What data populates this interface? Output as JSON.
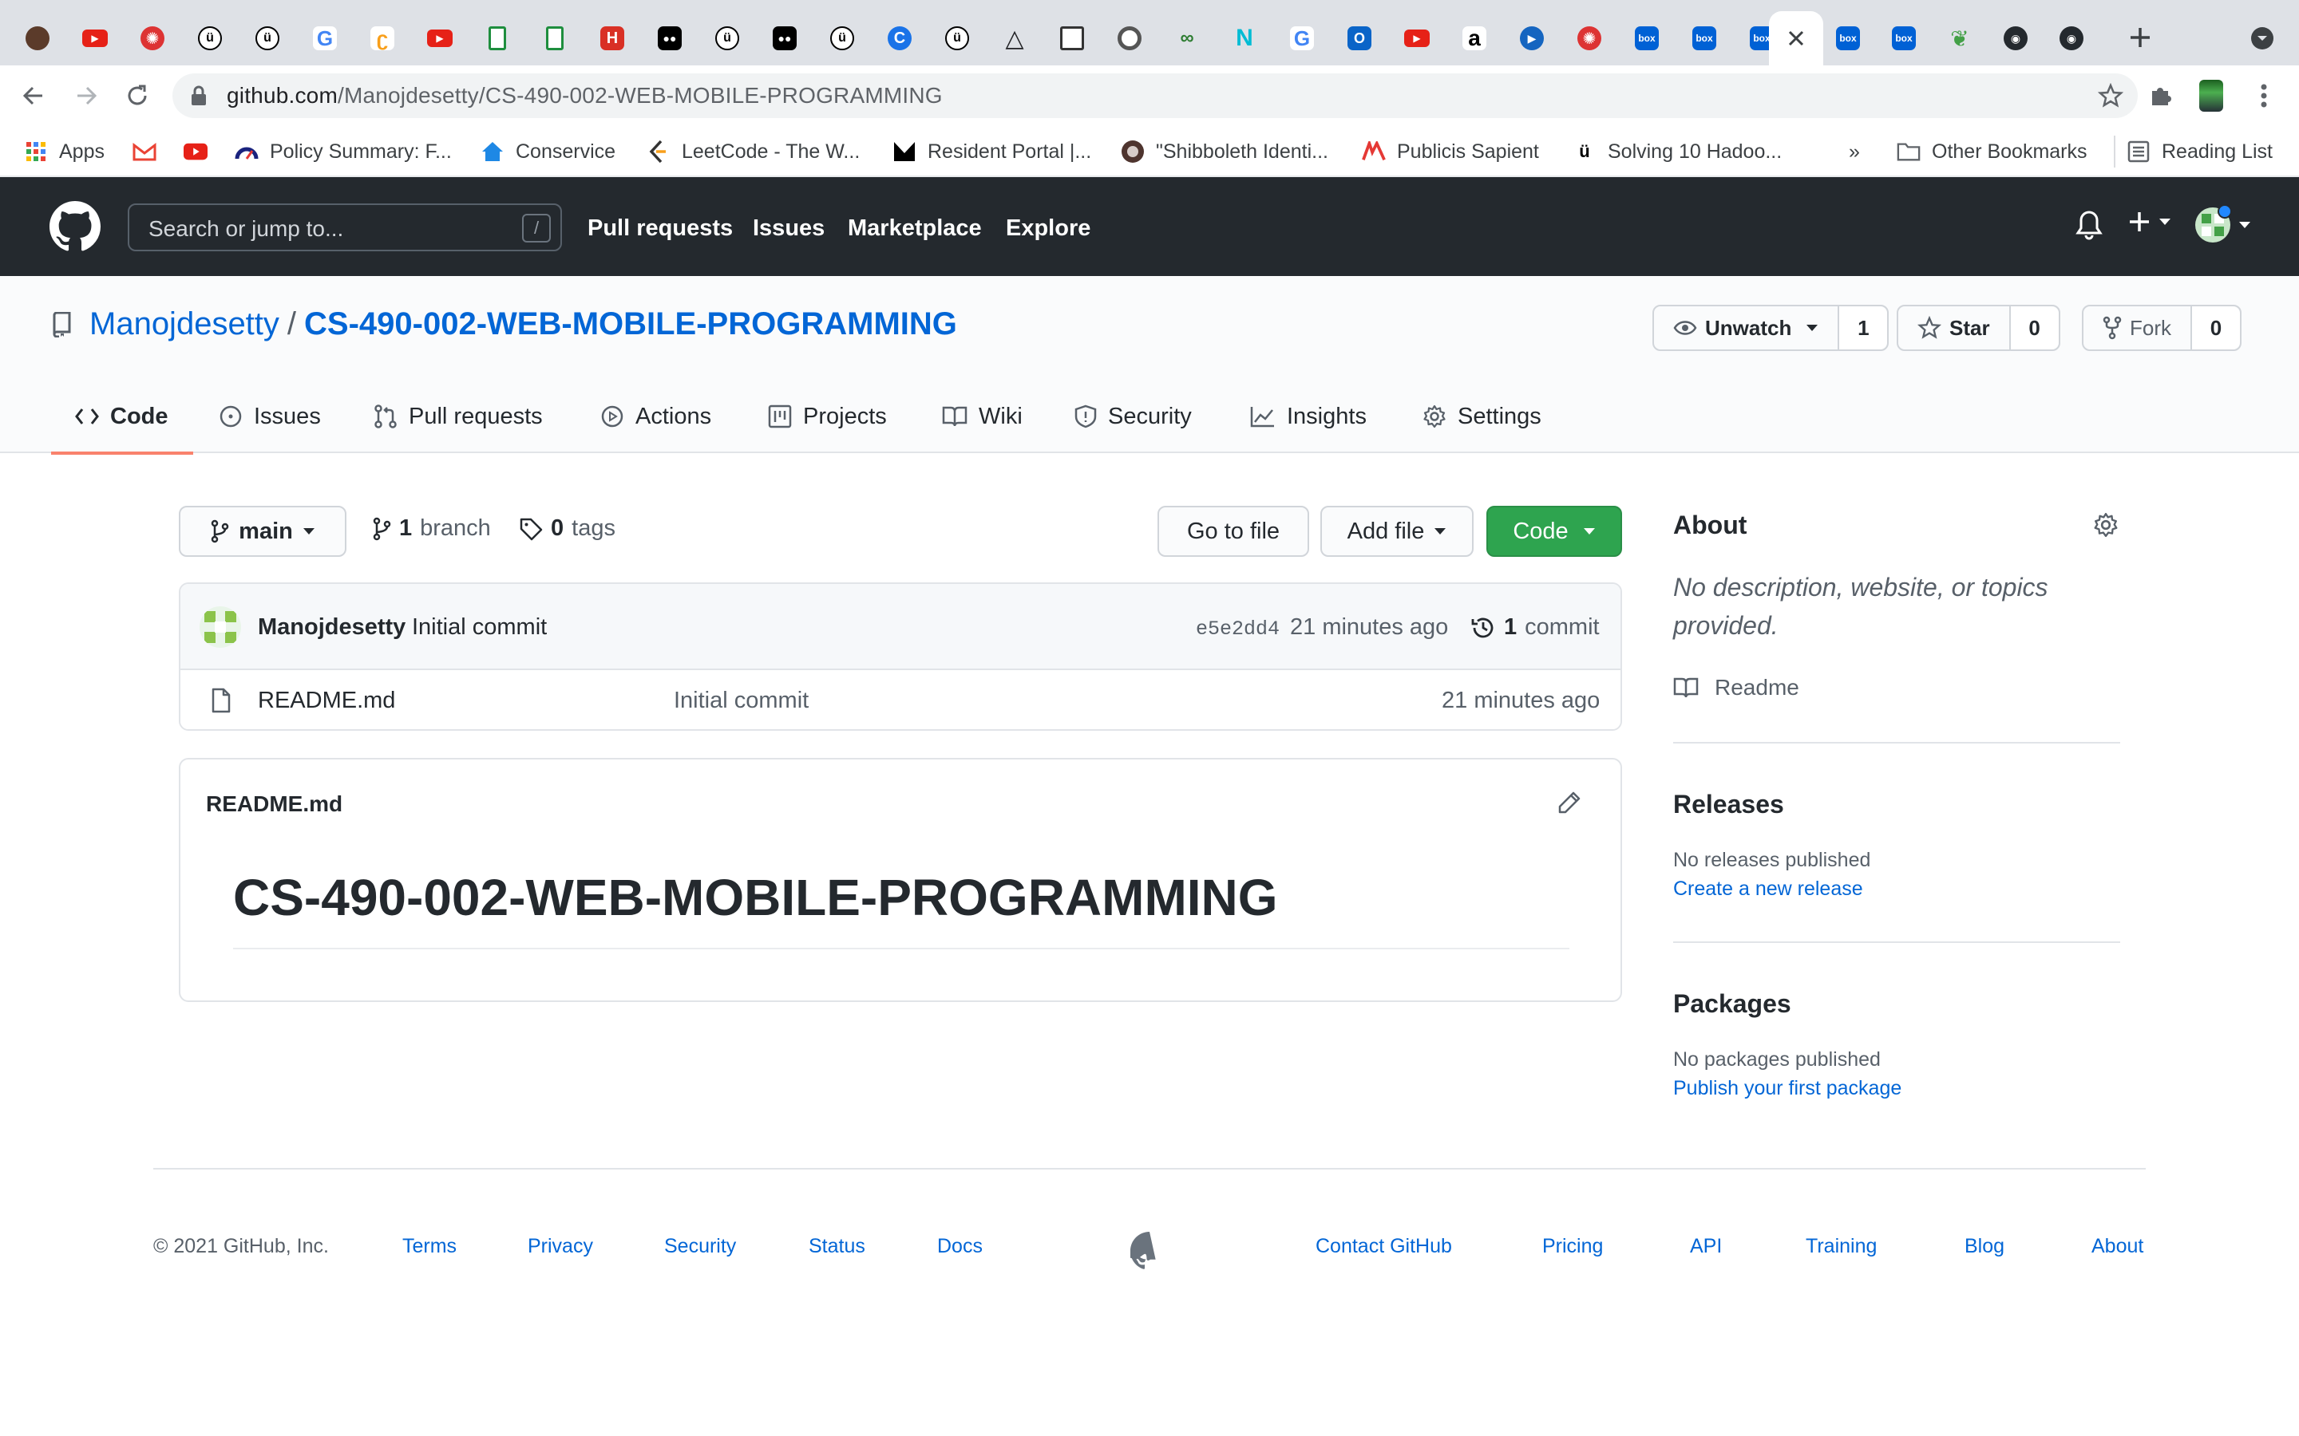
{
  "browser": {
    "tabs_favicon_names": [
      "chrome-icon",
      "youtube-icon",
      "stevens-icon",
      "udemy-icon",
      "udemy-icon",
      "google-icon",
      "leetcode-icon",
      "youtube-icon",
      "doc-icon",
      "doc-icon",
      "hackerrank-icon",
      "medium-icon",
      "udemy-icon",
      "medium-icon",
      "c-icon",
      "udemy-icon",
      "triangle-icon",
      "book-icon",
      "chrome-icon",
      "link-icon",
      "n-icon",
      "google-icon",
      "outlook-icon",
      "youtube-icon",
      "amazon-icon",
      "play-icon",
      "stevens-icon",
      "box-icon",
      "box-icon",
      "box-icon",
      "github-icon",
      "box-icon",
      "box-icon",
      "leaf-icon",
      "github-icon",
      "github-icon"
    ],
    "url_host": "github.com",
    "url_path": "/Manojdesetty/CS-490-002-WEB-MOBILE-PROGRAMMING",
    "bookmarks": {
      "apps": "Apps",
      "policy": "Policy Summary: F...",
      "conservice": "Conservice",
      "leetcode": "LeetCode - The W...",
      "resident": "Resident Portal |...",
      "shibboleth": "\"Shibboleth Identi...",
      "publicis": "Publicis Sapient",
      "hadoop": "Solving 10 Hadoo...",
      "more": "»",
      "other": "Other Bookmarks",
      "reading": "Reading List"
    }
  },
  "github_header": {
    "search_placeholder": "Search or jump to...",
    "search_shortcut": "/",
    "nav": [
      "Pull requests",
      "Issues",
      "Marketplace",
      "Explore"
    ]
  },
  "repo": {
    "owner": "Manojdesetty",
    "separator": "/",
    "name": "CS-490-002-WEB-MOBILE-PROGRAMMING",
    "watch_label": "Unwatch",
    "watch_count": "1",
    "star_label": "Star",
    "star_count": "0",
    "fork_label": "Fork",
    "fork_count": "0",
    "tabs": [
      "Code",
      "Issues",
      "Pull requests",
      "Actions",
      "Projects",
      "Wiki",
      "Security",
      "Insights",
      "Settings"
    ],
    "selected_tab": "Code"
  },
  "code": {
    "branch": "main",
    "branch_count": "1",
    "branch_label": "branch",
    "tag_count": "0",
    "tag_label": "tags",
    "go_to_file": "Go to file",
    "add_file": "Add file",
    "code_button": "Code",
    "commit": {
      "author": "Manojdesetty",
      "message": "Initial commit",
      "sha": "e5e2dd4",
      "time": "21 minutes ago",
      "count": "1",
      "count_label": "commit"
    },
    "files": [
      {
        "name": "README.md",
        "message": "Initial commit",
        "time": "21 minutes ago"
      }
    ],
    "readme_title": "README.md",
    "readme_heading": "CS-490-002-WEB-MOBILE-PROGRAMMING"
  },
  "sidebar": {
    "about_title": "About",
    "about_text_line1": "No description, website, or topics",
    "about_text_line2": "provided.",
    "readme_link": "Readme",
    "releases_title": "Releases",
    "releases_text": "No releases published",
    "releases_link": "Create a new release",
    "packages_title": "Packages",
    "packages_text": "No packages published",
    "packages_link": "Publish your first package"
  },
  "footer": {
    "copyright": "© 2021 GitHub, Inc.",
    "left_links": [
      "Terms",
      "Privacy",
      "Security",
      "Status",
      "Docs"
    ],
    "right_links": [
      "Contact GitHub",
      "Pricing",
      "API",
      "Training",
      "Blog",
      "About"
    ]
  },
  "colors": {
    "github_header_bg": "#24292e",
    "link_blue": "#0366d6",
    "green_button": "#2ea44f",
    "selected_tab_underline": "#f9826c"
  }
}
